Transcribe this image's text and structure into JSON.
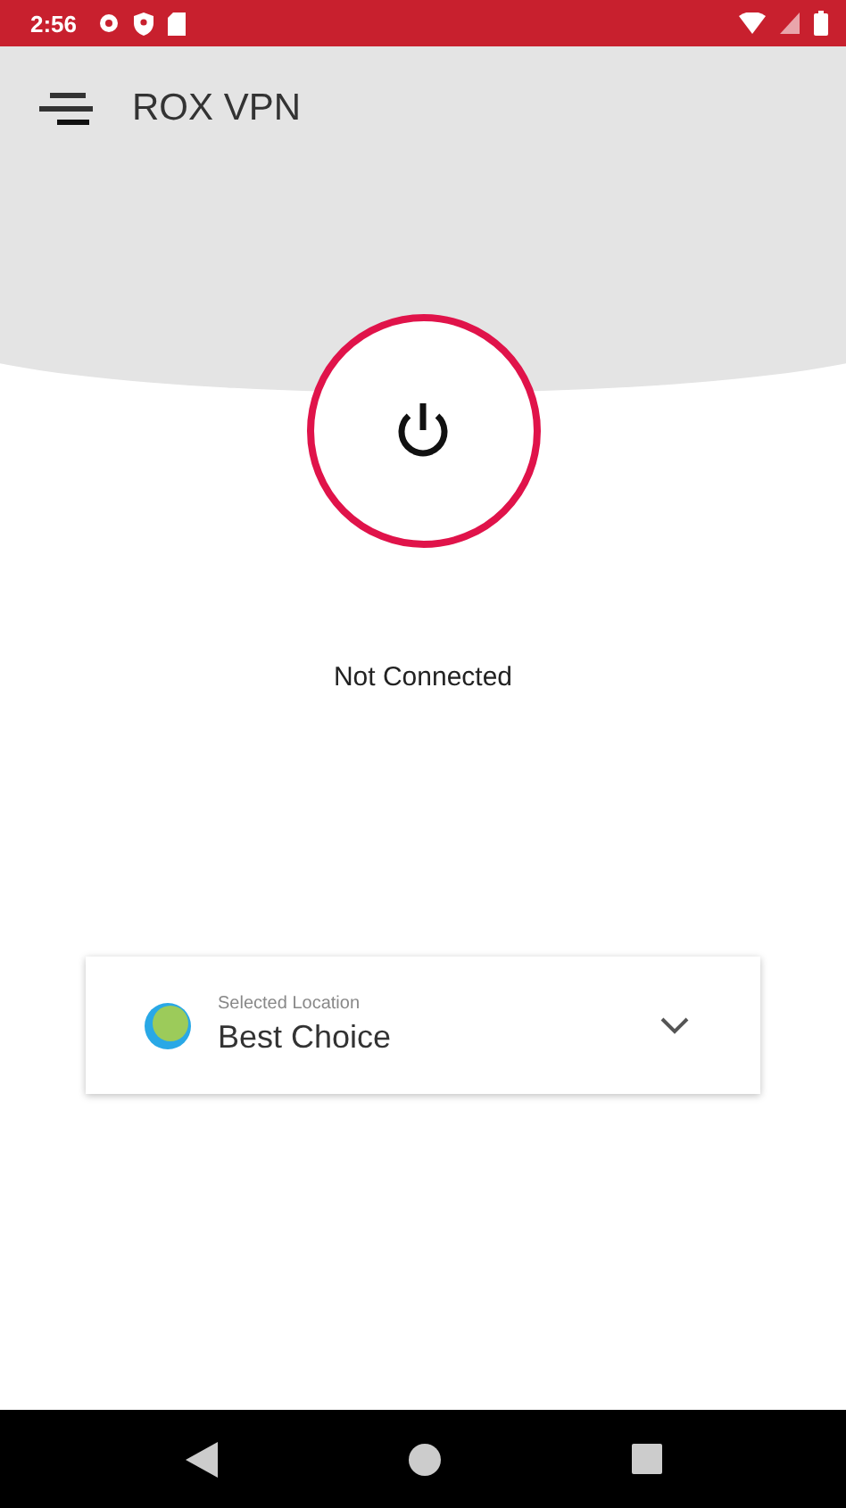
{
  "status_bar": {
    "time": "2:56"
  },
  "app_bar": {
    "title": "ROX VPN"
  },
  "connection": {
    "status": "Not Connected",
    "connected": false
  },
  "location": {
    "label": "Selected Location",
    "value": "Best Choice"
  }
}
